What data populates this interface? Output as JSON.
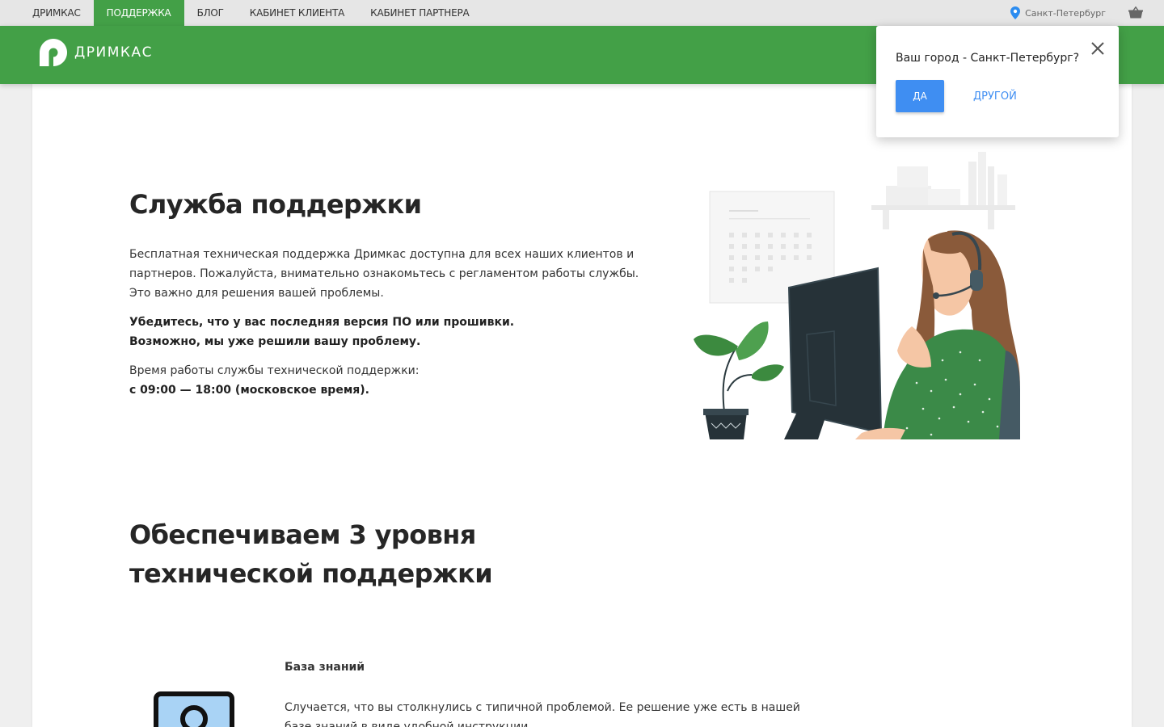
{
  "topnav": {
    "items": [
      {
        "label": "ДРИМКАС",
        "active": false
      },
      {
        "label": "ПОДДЕРЖКА",
        "active": true
      },
      {
        "label": "БЛОГ",
        "active": false
      },
      {
        "label": "КАБИНЕТ КЛИЕНТА",
        "active": false
      },
      {
        "label": "КАБИНЕТ ПАРТНЕРА",
        "active": false
      }
    ],
    "city": "Санкт-Петербург",
    "location_icon": "location-pin-icon",
    "cart_icon": "basket-icon"
  },
  "header": {
    "logo_text": "ДРИМКАС",
    "brand_color": "#43a047"
  },
  "hero": {
    "title": "Служба поддержки",
    "intro": "Бесплатная техническая поддержка Дримкас доступна для всех наших клиентов и партнеров. Пожалуйста, внимательно ознакомьтесь с регламентом работы службы. Это важно для решения вашей проблемы.",
    "notice_line1": "Убедитесь, что у вас последняя версия ПО или прошивки.",
    "notice_line2": "Возможно, мы уже решили вашу проблему.",
    "hours_label": "Время работы службы технической поддержки:",
    "hours_value": "с 09:00 — 18:00 (московское время)."
  },
  "levels": {
    "title_line1": "Обеспечиваем 3 уровня",
    "title_line2": "технической поддержки",
    "items": [
      {
        "title": "База знаний",
        "text": "Случается, что вы столкнулись с типичной проблемой. Ее решение уже есть в нашей базе знаний в виде удобной инструкции.",
        "icon": "knowledge-base-icon"
      }
    ]
  },
  "city_popup": {
    "question": "Ваш город - Санкт-Петербург?",
    "yes_label": "ДА",
    "other_label": "ДРУГОЙ",
    "accent_color": "#3f8ef2"
  }
}
